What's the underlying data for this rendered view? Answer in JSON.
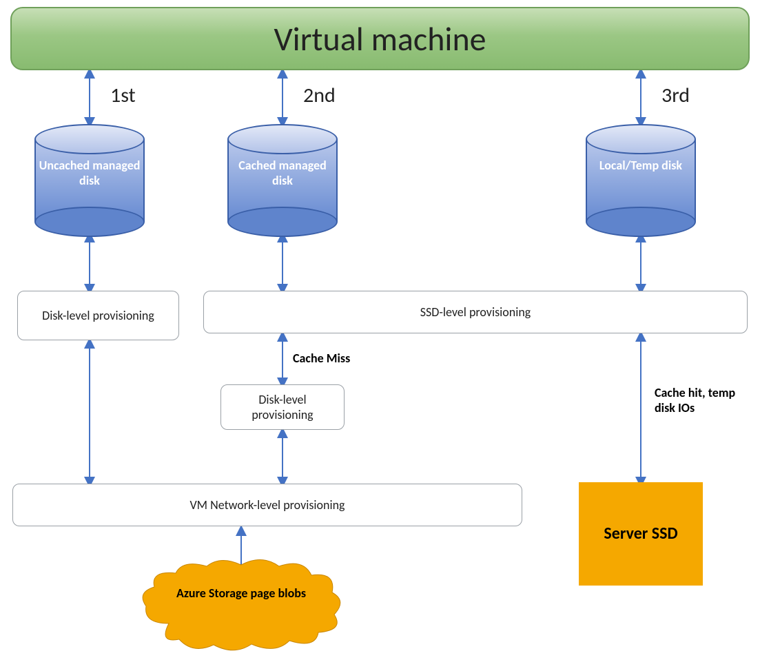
{
  "vm": {
    "title": "Virtual machine"
  },
  "columns": {
    "first": {
      "order": "1st",
      "cylinder": "Uncached managed disk"
    },
    "second": {
      "order": "2nd",
      "cylinder": "Cached managed disk"
    },
    "third": {
      "order": "3rd",
      "cylinder": "Local/Temp disk"
    }
  },
  "boxes": {
    "disk_level_1": "Disk-level provisioning",
    "ssd_level": "SSD-level provisioning",
    "disk_level_2": "Disk-level provisioning",
    "vm_network": "VM Network-level provisioning",
    "server_ssd": "Server SSD"
  },
  "labels": {
    "cache_miss": "Cache Miss",
    "cache_hit": "Cache hit, temp disk IOs"
  },
  "cloud": {
    "label": "Azure Storage page blobs"
  },
  "colors": {
    "arrow": "#4472C4",
    "orange": "#F5A800",
    "vm_gradient_top": "#C7DFB6",
    "vm_gradient_bottom": "#88BB70",
    "cylinder_top": "#B9C8EB",
    "cylinder_bottom": "#5F84CC"
  }
}
